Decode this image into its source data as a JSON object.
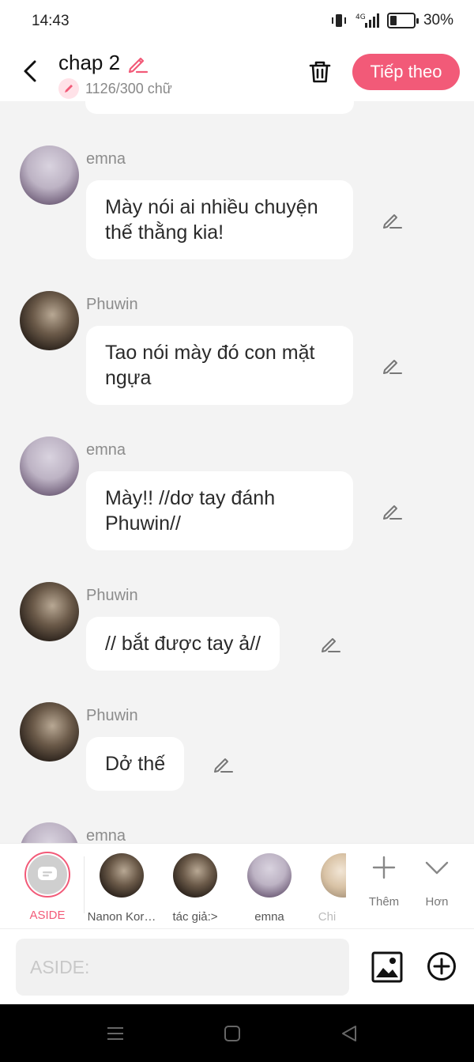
{
  "status": {
    "time": "14:43",
    "battery": "30%",
    "network": "4G",
    "battery_level": 0.3
  },
  "header": {
    "title": "chap 2",
    "word_count": "1126/300 chữ",
    "next_label": "Tiếp theo"
  },
  "messages": [
    {
      "sender": "emna",
      "text": "Mày nói ai nhiều chuyện thế thằng kia!",
      "avatar": "emna-avatar"
    },
    {
      "sender": "Phuwin",
      "text": "Tao nói mày đó con mặt ngựa",
      "avatar": "phuwin-avatar"
    },
    {
      "sender": "emna",
      "text": "Mày!! //dơ tay đánh Phuwin//",
      "avatar": "emna-avatar"
    },
    {
      "sender": "Phuwin",
      "text": "// bắt được tay ả//",
      "avatar": "phuwin-avatar"
    },
    {
      "sender": "Phuwin",
      "text": "Dở thế",
      "avatar": "phuwin-avatar"
    },
    {
      "sender": "emna",
      "text": "",
      "avatar": "emna-avatar"
    }
  ],
  "characters": [
    {
      "label": "ASIDE",
      "selected": true
    },
    {
      "label": "Nanon Kor…"
    },
    {
      "label": "tác giả:>"
    },
    {
      "label": "emna"
    },
    {
      "label": "Chi"
    }
  ],
  "tools": {
    "add_label": "Thêm",
    "more_label": "Hơn"
  },
  "composer": {
    "placeholder": "ASIDE:"
  },
  "colors": {
    "accent": "#f25a78",
    "background": "#f3f3f3",
    "bubble": "#ffffff"
  }
}
